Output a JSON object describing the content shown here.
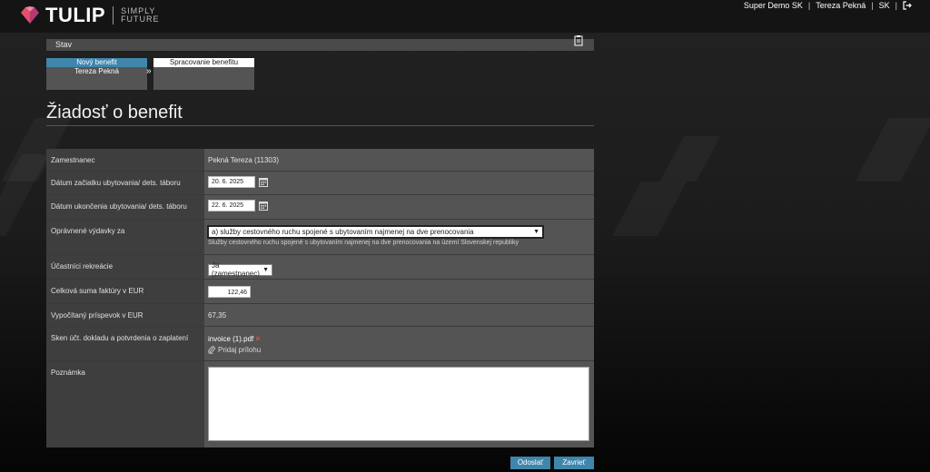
{
  "header": {
    "brand": "TULIP",
    "tagline_1": "SIMPLY",
    "tagline_2": "FUTURE",
    "company": "Super Demo SK",
    "user": "Tereza Pekná",
    "language": "SK",
    "separator": "|",
    "logo_colors": [
      "#e84d6b",
      "#f28aa0",
      "#b23a75"
    ]
  },
  "status_bar": {
    "label": "Stav"
  },
  "steps": [
    {
      "title": "Nový benefit",
      "subtitle": "Tereza Pekná"
    },
    {
      "title": "Spracovanie benefitu",
      "subtitle": ""
    }
  ],
  "step_arrow": "»",
  "page": {
    "title": "Žiadosť o benefit"
  },
  "form": {
    "employee": {
      "label": "Zamestnanec",
      "value": "Pekná Tereza (11303)"
    },
    "start_date": {
      "label": "Dátum začiatku ubytovania/ dets. táboru",
      "value": "20. 6. 2025"
    },
    "end_date": {
      "label": "Dátum ukončenia ubytovania/ dets. táboru",
      "value": "22. 6. 2025"
    },
    "expenses": {
      "label": "Oprávnené výdavky za",
      "selected": "a) služby cestovného ruchu spojené s ubytovaním najmenej na dve prenocovania",
      "description": "Služby cestovného ruchu spojené s ubytovaním najmenej na dve prenocovania na území Slovenskej republiky"
    },
    "participants": {
      "label": "Účastníci rekreácie",
      "selected": "Ja (zamestnanec)"
    },
    "invoice_total": {
      "label": "Celková suma faktúry v EUR",
      "value": "122,46"
    },
    "calculated": {
      "label": "Vypočítaný príspevok v EUR",
      "value": "67,35"
    },
    "scan": {
      "label": "Sken účt. dokladu a potvrdenia o zaplatení",
      "file_name": "invoice (1).pdf",
      "remove_glyph": "×",
      "add_attachment": "Pridaj prílohu"
    },
    "note": {
      "label": "Poznámka",
      "value": ""
    }
  },
  "buttons": {
    "send": "Odoslať",
    "close": "Zavrieť"
  },
  "colors": {
    "accent": "#3f86ad",
    "remove": "#e04a4a"
  }
}
